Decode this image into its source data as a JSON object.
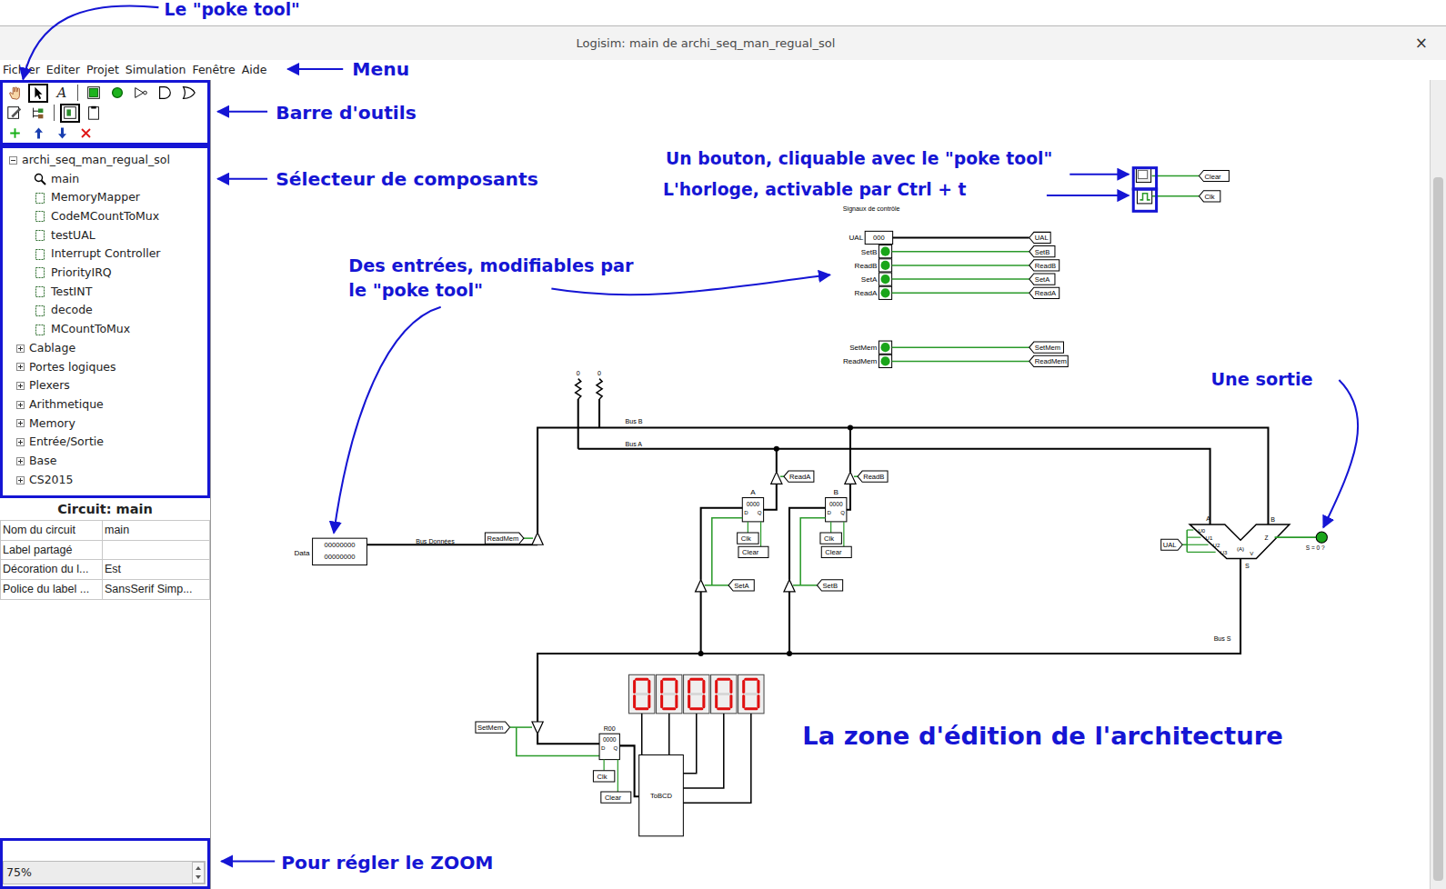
{
  "annotations": [
    {
      "lines": [
        "Le \"poke tool\""
      ]
    },
    {
      "lines": [
        "Menu"
      ]
    },
    {
      "lines": [
        "Barre d'outils"
      ]
    },
    {
      "lines": [
        "Sélecteur de composants"
      ]
    },
    {
      "lines": [
        "Un bouton, cliquable avec le \"poke tool\""
      ]
    },
    {
      "lines": [
        "L'horloge, activable par Ctrl + t"
      ]
    },
    {
      "lines": [
        "Des entrées, modifiables par",
        "le \"poke tool\""
      ]
    },
    {
      "lines": [
        "Une sortie"
      ]
    },
    {
      "lines": [
        "La zone d'édition de l'architecture"
      ]
    },
    {
      "lines": [
        "Pour régler le ZOOM"
      ]
    }
  ],
  "window": {
    "title": "Logisim: main de archi_seq_man_regual_sol",
    "close": "×"
  },
  "menu": [
    "Fichier",
    "Editer",
    "Projet",
    "Simulation",
    "Fenêtre",
    "Aide"
  ],
  "toolbar": {
    "rows": [
      [
        [
          {
            "kind": "poke",
            "selected": false
          },
          {
            "kind": "select",
            "selected": true
          },
          {
            "kind": "text",
            "label": "A",
            "selected": false
          }
        ],
        [
          {
            "kind": "pin-in",
            "selected": false
          },
          {
            "kind": "pin-out",
            "selected": false
          },
          {
            "kind": "not",
            "selected": false
          },
          {
            "kind": "and",
            "selected": false
          },
          {
            "kind": "or",
            "selected": false
          }
        ]
      ],
      [
        [
          {
            "kind": "edit",
            "selected": false
          },
          {
            "kind": "simtree",
            "selected": false
          }
        ],
        [
          {
            "kind": "layout",
            "selected": true
          },
          {
            "kind": "clipboard",
            "selected": false
          }
        ]
      ],
      [
        [
          {
            "kind": "add"
          },
          {
            "kind": "up"
          },
          {
            "kind": "down"
          },
          {
            "kind": "delete"
          }
        ]
      ]
    ]
  },
  "tree": {
    "root": {
      "label": "archi_seq_man_regual_sol",
      "expanded": true
    },
    "circuits": [
      {
        "label": "main",
        "current": true
      },
      {
        "label": "MemoryMapper",
        "current": false
      },
      {
        "label": "CodeMCountToMux",
        "current": false
      },
      {
        "label": "testUAL",
        "current": false
      },
      {
        "label": "Interrupt Controller",
        "current": false
      },
      {
        "label": "PriorityIRQ",
        "current": false
      },
      {
        "label": "TestINT",
        "current": false
      },
      {
        "label": "decode",
        "current": false
      },
      {
        "label": "MCountToMux",
        "current": false
      }
    ],
    "libraries": [
      {
        "label": "Cablage",
        "expanded": false
      },
      {
        "label": "Portes logiques",
        "expanded": false
      },
      {
        "label": "Plexers",
        "expanded": false
      },
      {
        "label": "Arithmetique",
        "expanded": false
      },
      {
        "label": "Memory",
        "expanded": false
      },
      {
        "label": "Entrée/Sortie",
        "expanded": false
      },
      {
        "label": "Base",
        "expanded": false
      },
      {
        "label": "CS2015",
        "expanded": false
      }
    ]
  },
  "properties": {
    "title": "Circuit: main",
    "rows": [
      {
        "name": "Nom du circuit",
        "value": "main"
      },
      {
        "name": "Label partagé",
        "value": ""
      },
      {
        "name": "Décoration du l...",
        "value": "Est"
      },
      {
        "name": "Police du label ...",
        "value": "SansSerif Simp..."
      }
    ]
  },
  "zoom": {
    "value": "75%"
  },
  "vertical_scrollbar": {
    "level": 0.87
  },
  "circuit": {
    "top_tunnels": [
      "Clear",
      "Clk"
    ],
    "title": "Signaux de contrôle",
    "op_input": {
      "label": "UAL",
      "value": "000",
      "tunnel": "UAL"
    },
    "inputs": [
      {
        "label": "SetB",
        "tunnel": "SetB",
        "on": false
      },
      {
        "label": "ReadB",
        "tunnel": "ReadB",
        "on": false
      },
      {
        "label": "SetA",
        "tunnel": "SetA",
        "on": false
      },
      {
        "label": "ReadA",
        "tunnel": "ReadA",
        "on": false
      }
    ],
    "mem_inputs": [
      {
        "label": "SetMem",
        "tunnel": "SetMem",
        "on": false
      },
      {
        "label": "ReadMem",
        "tunnel": "ReadMem",
        "on": false
      }
    ],
    "pullups": [
      "0",
      "0"
    ],
    "buses": {
      "b": "Bus B",
      "a": "Bus A",
      "s": "Bus S",
      "data": "Bus Données"
    },
    "registers": [
      {
        "name": "A",
        "value": "0000",
        "d": "D",
        "q": "Q",
        "read": "ReadA",
        "set": "SetA",
        "clk": "Clk",
        "clear": "Clear"
      },
      {
        "name": "B",
        "value": "0000",
        "d": "D",
        "q": "Q",
        "read": "ReadB",
        "set": "SetB",
        "clk": "Clk",
        "clear": "Clear"
      }
    ],
    "data_source": {
      "label": "Data",
      "lines": [
        "00000000",
        "00000000"
      ],
      "read": "ReadMem"
    },
    "alu": {
      "a": "A",
      "b": "B",
      "op": "UAL",
      "pins": [
        "U0",
        "U1",
        "U2",
        "U3"
      ],
      "mode": "(A)",
      "z": "Z",
      "v": "V",
      "s": "S"
    },
    "output": {
      "label": "S = 0 ?",
      "on": false
    },
    "mem_register": {
      "name": "R00",
      "value": "0000",
      "d": "D",
      "q": "Q",
      "set": "SetMem",
      "clk": "Clk",
      "clear": "Clear"
    },
    "bcd": "ToBCD",
    "display": [
      "0",
      "0",
      "0",
      "0",
      "0"
    ]
  }
}
